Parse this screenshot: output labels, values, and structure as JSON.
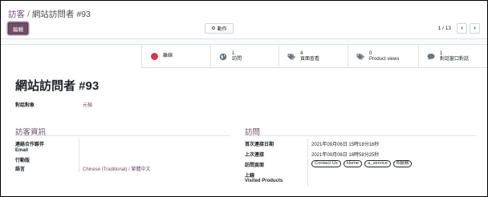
{
  "breadcrumb": {
    "parent": "訪客",
    "separator": "/",
    "current": "網站訪問者 #93"
  },
  "toolbar": {
    "edit_label": "編輯",
    "action_label": "動作"
  },
  "pager": {
    "value": "1 / 13",
    "prev_icon": "chevron-left-icon",
    "next_icon": "chevron-right-icon"
  },
  "colors": {
    "brand": "#714B67",
    "status_red": "#dc3545"
  },
  "stat_buttons": [
    {
      "icon": "status-dot-icon",
      "label": "離線"
    },
    {
      "icon": "globe-icon",
      "value": "1",
      "label": "訪問"
    },
    {
      "icon": "tags-icon",
      "value": "4",
      "label": "頁面查看"
    },
    {
      "icon": "tags-icon",
      "value": "0",
      "label": "Product views"
    },
    {
      "icon": "comment-icon",
      "value": "1",
      "label": "對話窗口對話"
    }
  ],
  "title": "網站訪問者 #93",
  "fields_top": {
    "conversation_label": "對話對象",
    "conversation_value": "元楨"
  },
  "visitor_info": {
    "section_title": "訪客資訊",
    "contact_partner_label": "連絡合作夥伴",
    "email_label": "Email",
    "mobile_label": "行動版",
    "language_label": "語言",
    "language_value": "Chinese (Traditional) / 繁體中文"
  },
  "visits": {
    "section_title": "訪問",
    "first_visit_label": "首次連接日期",
    "first_visit_value": "2021年09月06日 15時18分16秒",
    "last_visit_label": "上次連接",
    "last_visit_value": "2021年09月06日 16時58分25秒",
    "pages_label": "訪問頁面",
    "pages_tags": [
      "Contact Us",
      "Home",
      "a_service",
      "B服務"
    ],
    "online_label": "上線",
    "products_label": "Visited Products"
  }
}
